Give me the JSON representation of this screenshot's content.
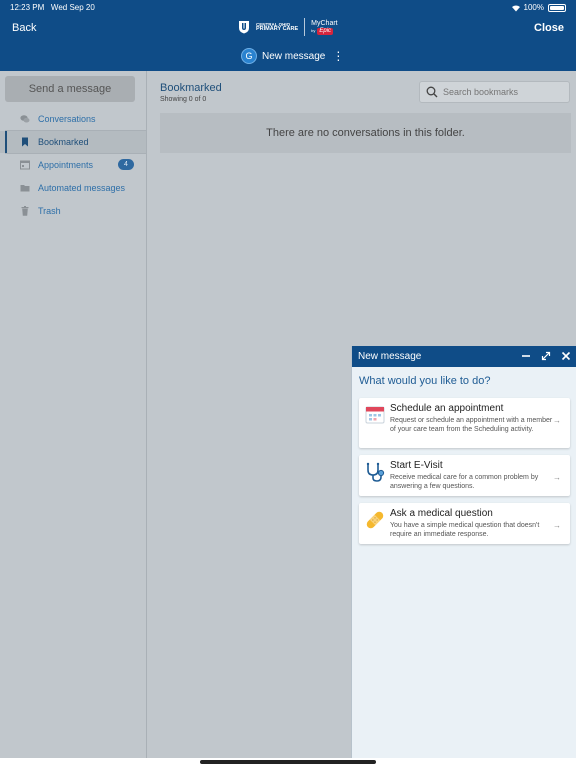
{
  "status": {
    "time": "12:23 PM",
    "date": "Wed Sep 20",
    "battery": "100%"
  },
  "header": {
    "back_label": "Back",
    "close_label": "Close",
    "logo_line1": "CENTRAL OHIO",
    "logo_line2": "PRIMARY CARE",
    "mychart_label": "MyChart",
    "mychart_by": "by",
    "epic_label": "Epic",
    "avatar_initial": "G",
    "new_message_label": "New message"
  },
  "sidebar": {
    "send_button": "Send a message",
    "items": [
      {
        "label": "Conversations",
        "icon": "chat-bubbles-icon"
      },
      {
        "label": "Bookmarked",
        "icon": "bookmark-icon"
      },
      {
        "label": "Appointments",
        "icon": "calendar-icon",
        "badge": "4"
      },
      {
        "label": "Automated messages",
        "icon": "folder-icon"
      },
      {
        "label": "Trash",
        "icon": "trash-icon"
      }
    ]
  },
  "main": {
    "title": "Bookmarked",
    "subtitle": "Showing 0 of 0",
    "search_placeholder": "Search bookmarks",
    "empty_text": "There are no conversations in this folder."
  },
  "panel": {
    "title": "New message",
    "question": "What would you like to do?",
    "options": [
      {
        "title": "Schedule an appointment",
        "desc": "Request or schedule an appointment with a member of your care team from the Scheduling activity.",
        "icon": "calendar-icon"
      },
      {
        "title": "Start E-Visit",
        "desc": "Receive medical care for a common problem by answering a few questions.",
        "icon": "stethoscope-icon"
      },
      {
        "title": "Ask a medical question",
        "desc": "You have a simple medical question that doesn't require an immediate response.",
        "icon": "bandage-icon"
      }
    ]
  },
  "colors": {
    "brand": "#0f4c87",
    "link": "#2e6fa8",
    "epic_red": "#d6253d"
  }
}
